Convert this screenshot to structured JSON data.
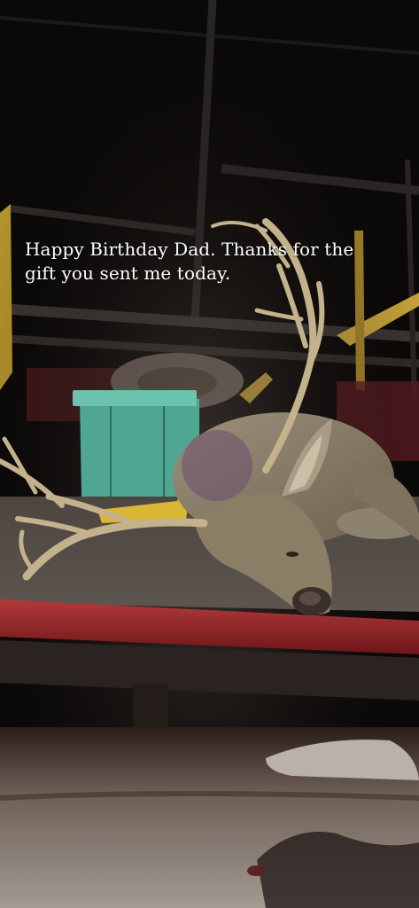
{
  "story": {
    "caption_lines": [
      "Happy Birthday Dad. Thanks for the",
      "gift you sent me today."
    ]
  },
  "colors": {
    "night_background": "#0b0908",
    "truck_red": "#8e1d22",
    "cooler_teal": "#5fb7a4",
    "strap_yellow": "#d9b634",
    "deer_fur": "#8a7e66",
    "antler": "#c9b691",
    "ground": "#9a9189"
  },
  "icons": []
}
